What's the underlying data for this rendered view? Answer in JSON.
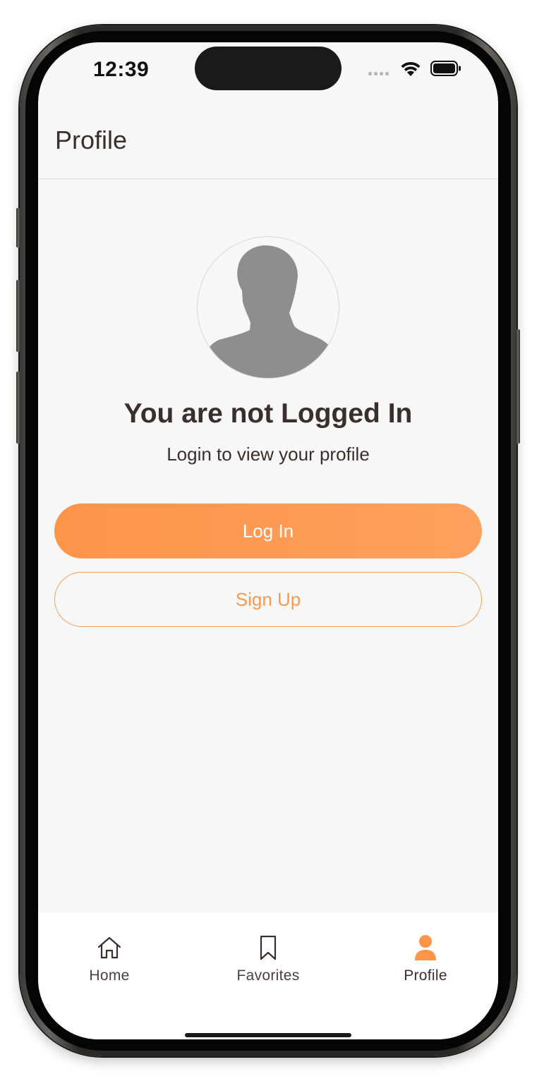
{
  "status_bar": {
    "time": "12:39"
  },
  "header": {
    "title": "Profile"
  },
  "profile": {
    "avatar_icon": "person-silhouette-icon",
    "heading": "You are not Logged In",
    "subtitle": "Login to view your profile"
  },
  "actions": {
    "login_label": "Log In",
    "signup_label": "Sign Up"
  },
  "tabbar": {
    "items": [
      {
        "label": "Home",
        "icon": "home-icon",
        "active": false
      },
      {
        "label": "Favorites",
        "icon": "bookmark-icon",
        "active": false
      },
      {
        "label": "Profile",
        "icon": "person-icon",
        "active": true
      }
    ]
  },
  "colors": {
    "accent": "#fe9448",
    "text_dark": "#3a2f2d",
    "background": "#f7f7f7",
    "avatar_fill": "#8e8e8e"
  }
}
